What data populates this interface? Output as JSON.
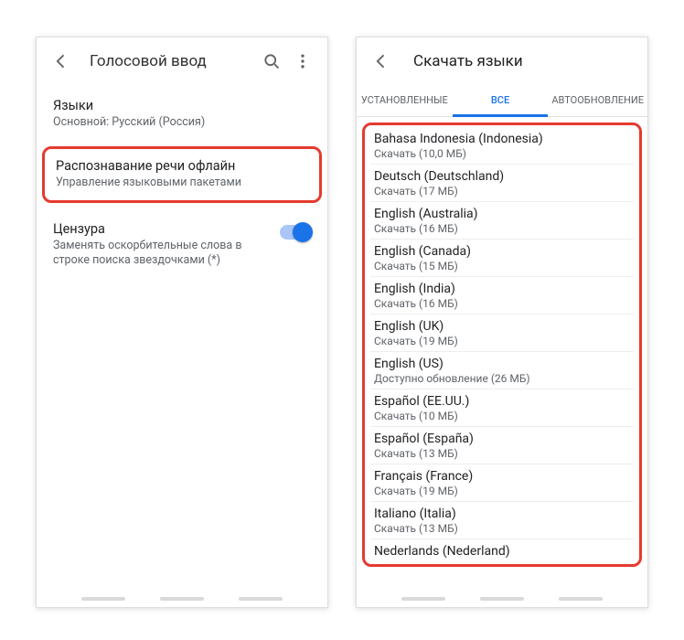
{
  "left": {
    "title": "Голосовой ввод",
    "languages": {
      "title": "Языки",
      "sub": "Основной: Русский (Россия)"
    },
    "offline": {
      "title": "Распознавание речи офлайн",
      "sub": "Управление языковыми пакетами"
    },
    "censor": {
      "title": "Цензура",
      "sub": "Заменять оскорбительные слова в строке поиска звездочками (*)"
    }
  },
  "right": {
    "title": "Скачать языки",
    "tabs": {
      "installed": "УСТАНОВЛЕННЫЕ",
      "all": "ВСЕ",
      "auto": "АВТООБНОВЛЕНИЕ"
    },
    "items": [
      {
        "name": "Bahasa Indonesia (Indonesia)",
        "sub": "Скачать (10,0 МБ)"
      },
      {
        "name": "Deutsch (Deutschland)",
        "sub": "Скачать (17 МБ)"
      },
      {
        "name": "English (Australia)",
        "sub": "Скачать (16 МБ)"
      },
      {
        "name": "English (Canada)",
        "sub": "Скачать (15 МБ)"
      },
      {
        "name": "English (India)",
        "sub": "Скачать (16 МБ)"
      },
      {
        "name": "English (UK)",
        "sub": "Скачать (19 МБ)"
      },
      {
        "name": "English (US)",
        "sub": "Доступно обновление (26 МБ)"
      },
      {
        "name": "Español (EE.UU.)",
        "sub": "Скачать (10 МБ)"
      },
      {
        "name": "Español (España)",
        "sub": "Скачать (13 МБ)"
      },
      {
        "name": "Français (France)",
        "sub": "Скачать (19 МБ)"
      },
      {
        "name": "Italiano (Italia)",
        "sub": "Скачать (13 МБ)"
      },
      {
        "name": "Nederlands (Nederland)",
        "sub": ""
      }
    ]
  }
}
